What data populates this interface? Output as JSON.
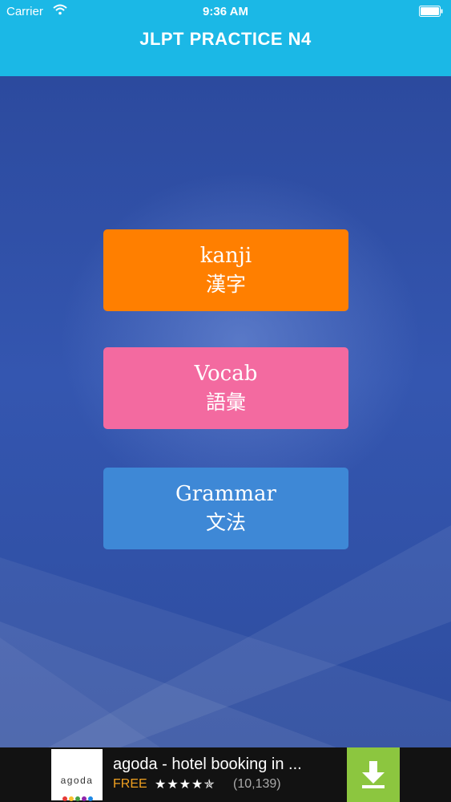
{
  "status_bar": {
    "carrier": "Carrier",
    "time": "9:36 AM"
  },
  "header": {
    "title": "JLPT PRACTICE N4",
    "color": "#1bb8e6"
  },
  "menu": {
    "kanji": {
      "label_en": "kanji",
      "label_jp": "漢字",
      "color": "#ff7f00"
    },
    "vocab": {
      "label_en": "Vocab",
      "label_jp": "語彙",
      "color": "#f36aa0"
    },
    "grammar": {
      "label_en": "Grammar",
      "label_jp": "文法",
      "color": "#3e88d6"
    }
  },
  "ad": {
    "logo_text": "agoda",
    "title": "agoda - hotel booking in ...",
    "price": "FREE",
    "stars": "★★★★✯",
    "rating": 4.5,
    "rating_count": "(10,139)",
    "download_icon": "download-arrow-icon",
    "download_color": "#8cc63f"
  }
}
